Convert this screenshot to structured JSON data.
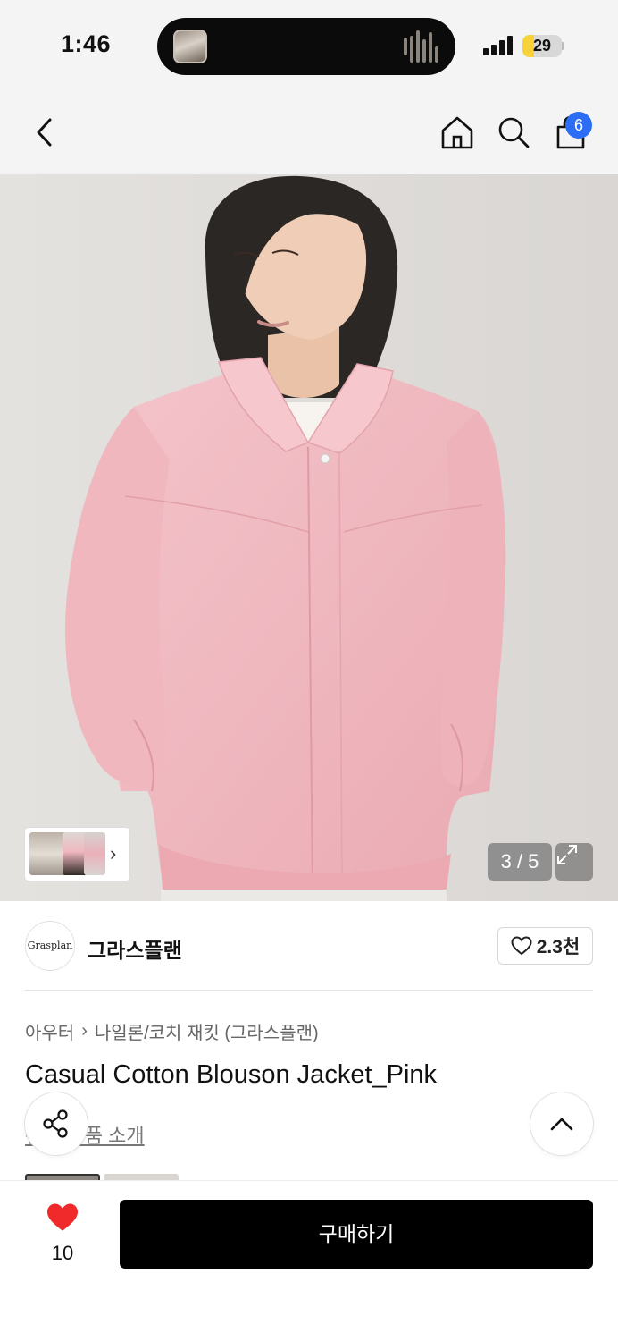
{
  "status_bar": {
    "time": "1:46",
    "battery": "29",
    "battery_level": 0.29,
    "icons": [
      "media-thumbnail-icon",
      "audio-waveform-icon",
      "signal-icon",
      "battery-icon"
    ]
  },
  "nav": {
    "icons": [
      "back-arrow-icon",
      "home-icon",
      "search-icon",
      "shopping-bag-icon"
    ],
    "cart_count": "6",
    "badge_color": "#2b6ef5"
  },
  "hero": {
    "counter": "3 / 5",
    "icons": [
      "chevron-right-icon",
      "expand-icon"
    ],
    "garment_color": "#f2b8bf"
  },
  "brand": {
    "logo_text": "Grasplan",
    "name": "그라스플랜",
    "likes": "2.3천"
  },
  "breadcrumb": {
    "category": "아우터",
    "subcategory": "나일론/코치 재킷 (그라스플랜)"
  },
  "product": {
    "title": "Casual Cotton Blouson Jacket_Pink",
    "related_link": "관련 상품 소개"
  },
  "bottom_bar": {
    "wish_count": "10",
    "buy_label": "구매하기",
    "heart_color": "#f02a2a",
    "button_color": "#000000"
  }
}
